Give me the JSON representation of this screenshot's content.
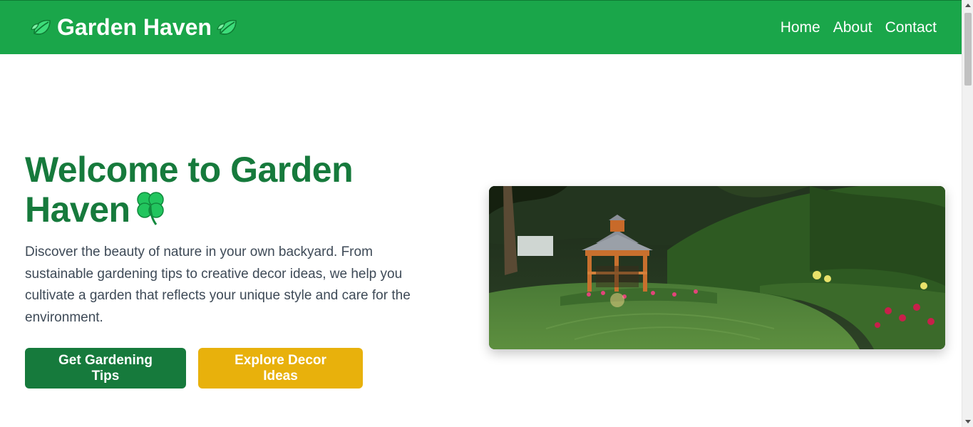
{
  "header": {
    "brand_name": "Garden Haven",
    "brand_icon_left": "leaf-icon",
    "brand_icon_right": "leaf-icon",
    "nav": [
      {
        "label": "Home"
      },
      {
        "label": "About"
      },
      {
        "label": "Contact"
      }
    ]
  },
  "hero": {
    "title": "Welcome to Garden Haven",
    "title_icon": "four-leaf-clover-icon",
    "description": "Discover the beauty of nature in your own backyard. From sustainable gardening tips to creative decor ideas, we help you cultivate a garden that reflects your unique style and care for the environment.",
    "primary_button": "Get Gardening Tips",
    "secondary_button": "Explore Decor Ideas",
    "image_subject": "backyard-garden-with-gazebo"
  },
  "colors": {
    "navbar": "#1aa64a",
    "title": "#167a3c",
    "primary_button": "#167a3c",
    "secondary_button": "#e8b10c",
    "body_text": "#3e4a57"
  }
}
